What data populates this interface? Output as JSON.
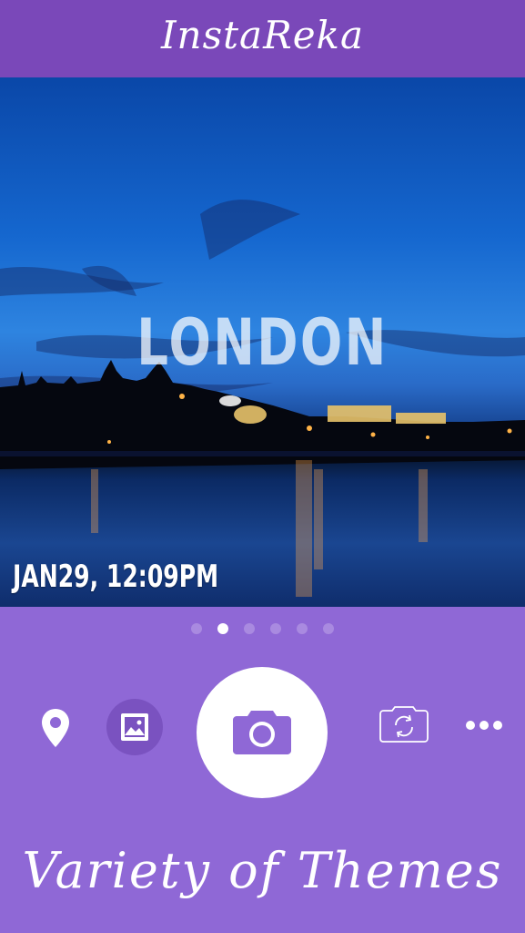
{
  "header": {
    "title": "InstaReka"
  },
  "photo": {
    "overlay_city": "LONDON",
    "timestamp": "JAN29, 12:09PM"
  },
  "pager": {
    "count": 6,
    "active_index": 1
  },
  "toolbar": {
    "icons": [
      "location-pin-icon",
      "gallery-icon",
      "camera-icon",
      "switch-camera-icon",
      "more-icon"
    ]
  },
  "tagline": "Variety of Themes",
  "colors": {
    "header": "#7a48b9",
    "background": "#8f68d6",
    "accent_button": "#7a52c0",
    "shutter_icon": "#8f68d6"
  }
}
